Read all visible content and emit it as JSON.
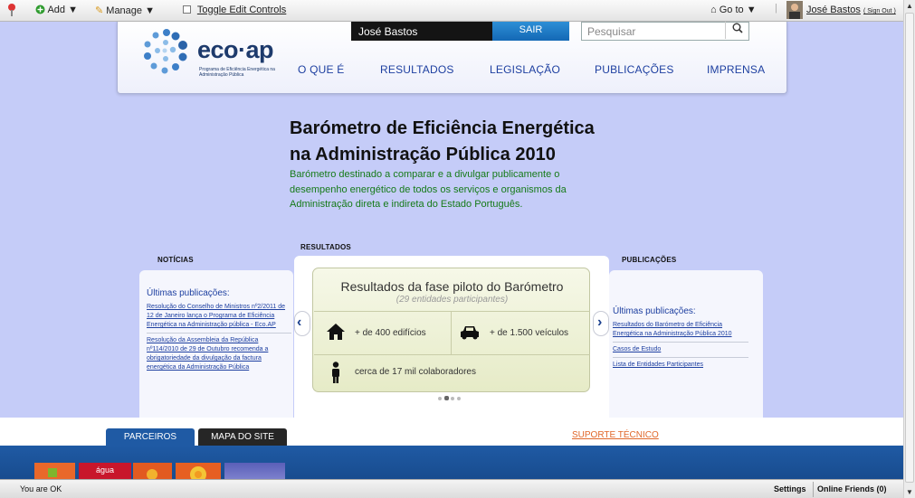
{
  "admin_bar": {
    "add_label": "Add",
    "manage_label": "Manage",
    "toggle_edit_label": "Toggle Edit Controls",
    "goto_label": "Go to",
    "user_name": "José Bastos",
    "sign_out_label": "( Sign Out )"
  },
  "header": {
    "logo_text": "eco·ap",
    "logo_subtitle": "Programa de Eficiência Energética na Administração Pública",
    "user_name": "José Bastos",
    "logout_label": "SAIR",
    "search_placeholder": "Pesquisar",
    "nav": [
      "O QUE É",
      "RESULTADOS",
      "LEGISLAÇÃO",
      "PUBLICAÇÕES",
      "IMPRENSA"
    ]
  },
  "hero": {
    "title_line1": "Barómetro de Eficiência Energética",
    "title_line2": "na Administração Pública 2010",
    "description": "Barómetro destinado a comparar e a divulgar publicamente o desempenho energético de todos os serviços e organismos da Administração direta e indireta do Estado Português."
  },
  "news": {
    "label": "NOTÍCIAS",
    "heading": "Últimas publicações:",
    "items": [
      "Resolução do Conselho de Ministros nº2/2011 de 12 de Janeiro lança o Programa de Eficiência Energética na Administração pública - Eco.AP",
      "Resolução da Assembleia da República nº114/2010 de 29 de Outubro recomenda a obrigatoriedade da divulgação da factura energética da Administração Pública"
    ]
  },
  "results": {
    "label": "RESULTADOS",
    "card_title": "Resultados da fase piloto do Barómetro",
    "card_subtitle": "(29 entidades participantes)",
    "stats": {
      "buildings": "+ de 400 edifícios",
      "vehicles": "+ de 1.500 veículos",
      "staff": "cerca de 17 mil colaboradores"
    },
    "page_dots": 4,
    "active_dot": 2
  },
  "publications": {
    "label": "PUBLICAÇÕES",
    "heading": "Últimas publicações:",
    "items": [
      "Resultados do Barómetro de Eficiência Energética na Administração Pública 2010",
      "Casos de Estudo",
      "Lista de Entidades Participantes"
    ]
  },
  "footer": {
    "tab_partners": "PARCEIROS",
    "tab_sitemap": "MAPA DO SITE",
    "support_link": "SUPORTE TÉCNICO",
    "partner_logo_text": "água"
  },
  "status_bar": {
    "status_text": "You are OK",
    "settings_label": "Settings",
    "online_friends_label": "Online Friends (0)"
  },
  "colors": {
    "page_background": "#c5ccf8",
    "nav_link": "#1d3fa0",
    "hero_description": "#157a18",
    "logout_button": "#1b78c6",
    "tab_partners": "#1f5aa4",
    "tab_sitemap": "#262626",
    "support_link": "#e0672a",
    "footer_band": "#1f5aa4"
  }
}
